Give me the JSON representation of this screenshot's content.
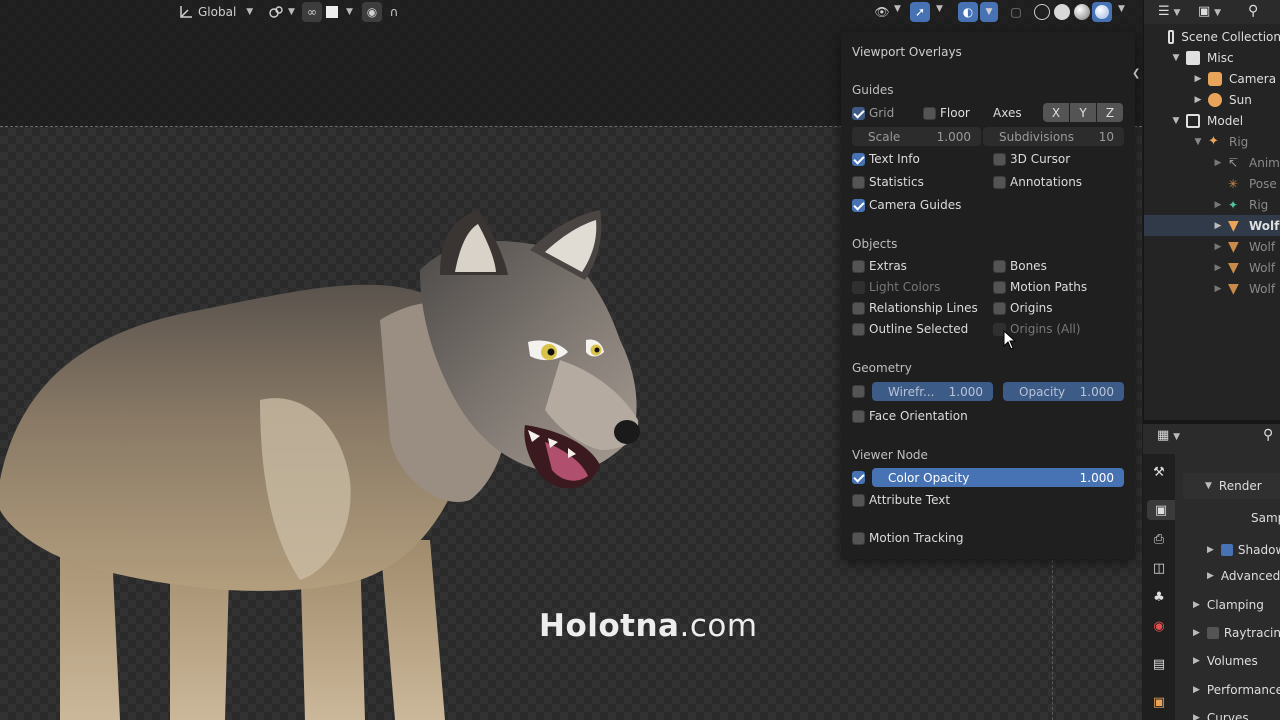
{
  "viewport_header": {
    "transform_orientation": "Global"
  },
  "overlays": {
    "title": "Viewport Overlays",
    "guides": {
      "header": "Guides",
      "grid": {
        "label": "Grid",
        "checked": true
      },
      "floor": {
        "label": "Floor",
        "checked": false
      },
      "axes_label": "Axes",
      "axes": [
        "X",
        "Y",
        "Z"
      ],
      "scale_label": "Scale",
      "scale_value": "1.000",
      "subdivisions_label": "Subdivisions",
      "subdivisions_value": "10",
      "text_info": {
        "label": "Text Info",
        "checked": true
      },
      "cursor_3d": {
        "label": "3D Cursor",
        "checked": false
      },
      "statistics": {
        "label": "Statistics",
        "checked": false
      },
      "annotations": {
        "label": "Annotations",
        "checked": false
      },
      "camera_guides": {
        "label": "Camera Guides",
        "checked": true
      }
    },
    "objects": {
      "header": "Objects",
      "extras": {
        "label": "Extras",
        "checked": false
      },
      "bones": {
        "label": "Bones",
        "checked": false
      },
      "light_colors": {
        "label": "Light Colors",
        "checked": false
      },
      "motion_paths": {
        "label": "Motion Paths",
        "checked": false
      },
      "relationship_lines": {
        "label": "Relationship Lines",
        "checked": false
      },
      "origins": {
        "label": "Origins",
        "checked": false
      },
      "outline_selected": {
        "label": "Outline Selected",
        "checked": false
      },
      "origins_all": {
        "label": "Origins (All)",
        "checked": false
      }
    },
    "geometry": {
      "header": "Geometry",
      "wireframe_label": "Wirefr...",
      "wireframe_value": "1.000",
      "opacity_label": "Opacity",
      "opacity_value": "1.000",
      "face_orientation": {
        "label": "Face Orientation",
        "checked": false
      }
    },
    "viewer_node": {
      "header": "Viewer Node",
      "color_opacity_label": "Color Opacity",
      "color_opacity_value": "1.000",
      "attribute_text": {
        "label": "Attribute Text",
        "checked": false
      }
    },
    "motion_tracking": {
      "label": "Motion Tracking",
      "checked": false
    }
  },
  "watermark": {
    "brand": "Holotna",
    "suffix": ".com"
  },
  "outliner": {
    "items": [
      {
        "label": "Scene Collection",
        "icon": "collection-icon"
      },
      {
        "label": "Misc",
        "icon": "collection-icon"
      },
      {
        "label": "Camera",
        "icon": "camera-icon"
      },
      {
        "label": "Sun",
        "icon": "light-icon"
      },
      {
        "label": "Model",
        "icon": "collection-icon"
      },
      {
        "label": "Rig",
        "icon": "armature-icon"
      },
      {
        "label": "Anim",
        "icon": "action-icon"
      },
      {
        "label": "Pose",
        "icon": "pose-icon"
      },
      {
        "label": "Rig",
        "icon": "armature-data-icon"
      },
      {
        "label": "Wolf",
        "icon": "mesh-icon"
      },
      {
        "label": "Wolf",
        "icon": "mesh-icon"
      },
      {
        "label": "Wolf",
        "icon": "mesh-icon"
      },
      {
        "label": "Wolf",
        "icon": "mesh-icon"
      }
    ]
  },
  "properties": {
    "render": "Render",
    "sampling": "Samp",
    "shadows": "Shadow",
    "advanced": "Advanced",
    "clamping": "Clamping",
    "raytracing": "Raytracing",
    "volumes": "Volumes",
    "performance": "Performance",
    "curves": "Curves"
  },
  "colors": {
    "accent": "#4772b3",
    "panel_bg": "#1f1f1f",
    "collection_icon": "#e0e0e0",
    "object_icon": "#e9a45a",
    "armature_icon": "#4fc2a0"
  }
}
